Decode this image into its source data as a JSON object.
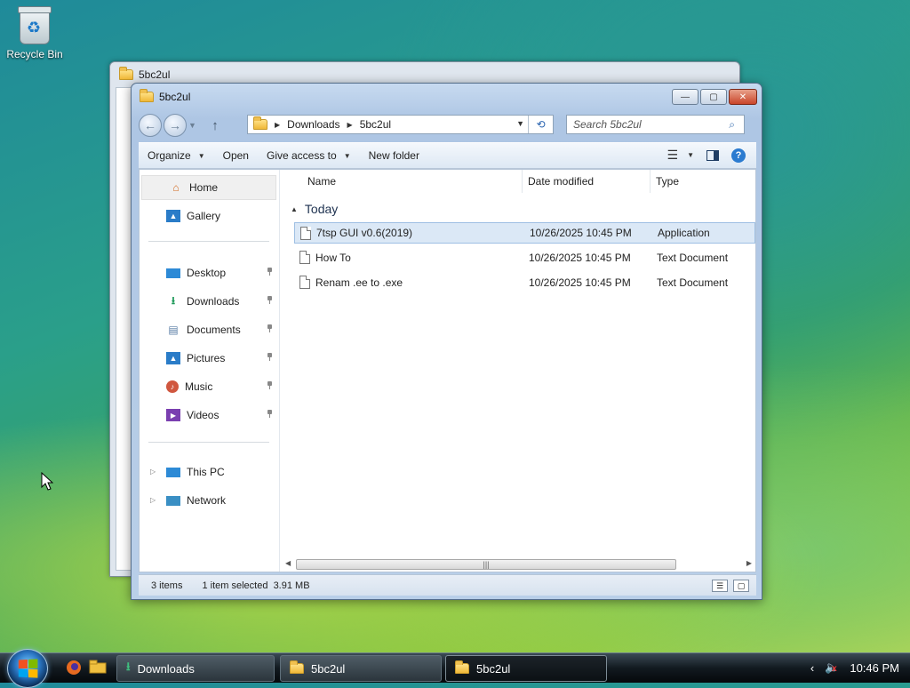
{
  "desktop": {
    "recycle_bin_label": "Recycle Bin"
  },
  "back_window": {
    "title": "5bc2ul"
  },
  "window": {
    "title": "5bc2ul",
    "address": {
      "segments": [
        "Downloads",
        "5bc2ul"
      ]
    },
    "search_placeholder": "Search 5bc2ul",
    "commands": {
      "organize": "Organize",
      "open": "Open",
      "give_access": "Give access to",
      "new_folder": "New folder"
    },
    "nav": {
      "home": "Home",
      "gallery": "Gallery",
      "quick": [
        {
          "label": "Desktop",
          "icon": "desktop-icon"
        },
        {
          "label": "Downloads",
          "icon": "download-icon"
        },
        {
          "label": "Documents",
          "icon": "documents-icon"
        },
        {
          "label": "Pictures",
          "icon": "pictures-icon"
        },
        {
          "label": "Music",
          "icon": "music-icon"
        },
        {
          "label": "Videos",
          "icon": "videos-icon"
        }
      ],
      "this_pc": "This PC",
      "network": "Network"
    },
    "columns": {
      "name": "Name",
      "date": "Date modified",
      "type": "Type"
    },
    "group_label": "Today",
    "files": [
      {
        "name": "7tsp GUI v0.6(2019)",
        "date": "10/26/2025 10:45 PM",
        "type": "Application",
        "selected": true
      },
      {
        "name": "How To",
        "date": "10/26/2025 10:45 PM",
        "type": "Text Document",
        "selected": false
      },
      {
        "name": "Renam .ee to .exe",
        "date": "10/26/2025 10:45 PM",
        "type": "Text Document",
        "selected": false
      }
    ],
    "status": {
      "count": "3 items",
      "selection": "1 item selected  3.91 MB"
    }
  },
  "taskbar": {
    "items": [
      {
        "label": "Downloads",
        "active": false
      },
      {
        "label": "5bc2ul",
        "active": false
      },
      {
        "label": "5bc2ul",
        "active": true
      }
    ],
    "clock": "10:46 PM"
  },
  "colors": {
    "accent": "#2b7bd0",
    "selection": "#dbe8f6",
    "close_button": "#c9452a"
  }
}
